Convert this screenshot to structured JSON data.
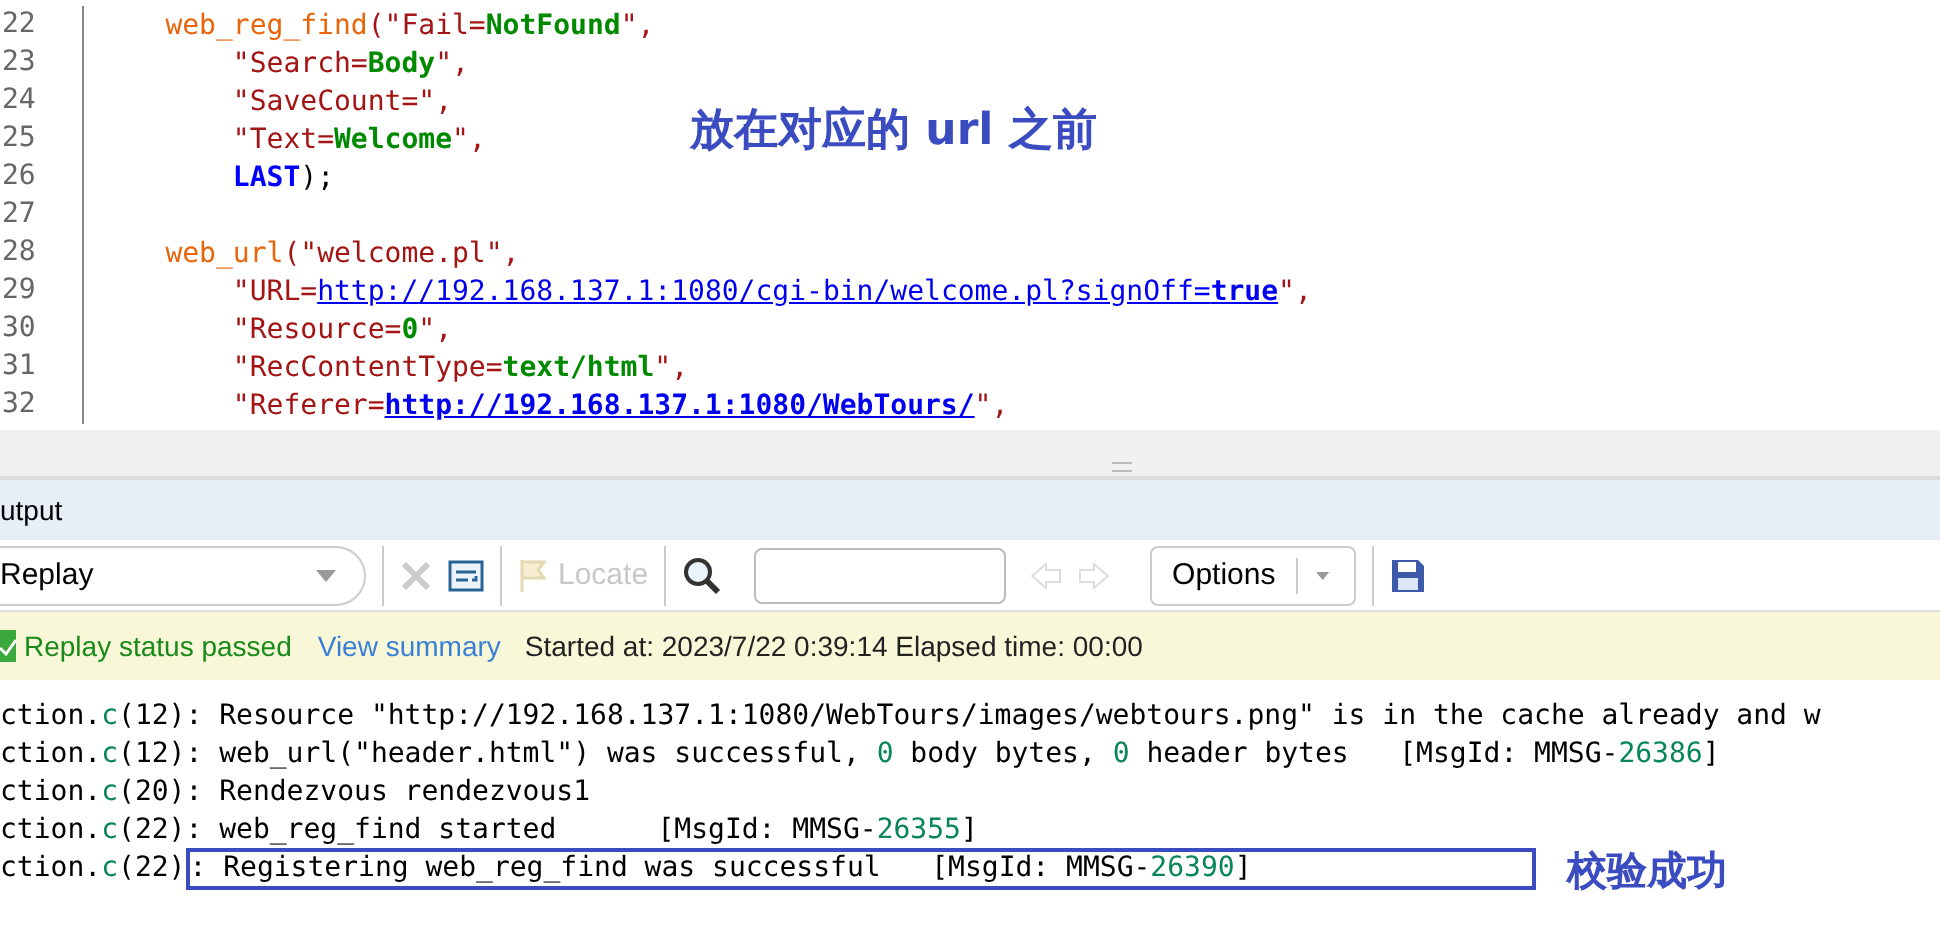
{
  "editor": {
    "lines": [
      {
        "number": "22",
        "kind": "call",
        "tokens": [
          {
            "t": "web_reg_find",
            "kind": "func"
          },
          {
            "t": "(\"Fail=",
            "kind": "str"
          },
          {
            "t": "NotFound",
            "kind": "val"
          },
          {
            "t": "\",",
            "kind": "str"
          }
        ]
      },
      {
        "number": "23",
        "kind": "arg",
        "tokens": [
          {
            "t": "\"Search=",
            "kind": "str"
          },
          {
            "t": "Body",
            "kind": "val"
          },
          {
            "t": "\",",
            "kind": "str"
          }
        ]
      },
      {
        "number": "24",
        "kind": "arg",
        "tokens": [
          {
            "t": "\"SaveCount=\",",
            "kind": "str"
          }
        ]
      },
      {
        "number": "25",
        "kind": "arg",
        "tokens": [
          {
            "t": "\"Text=",
            "kind": "str"
          },
          {
            "t": "Welcome",
            "kind": "val"
          },
          {
            "t": "\",",
            "kind": "str"
          }
        ]
      },
      {
        "number": "26",
        "kind": "arg",
        "tokens": [
          {
            "t": "LAST",
            "kind": "kw"
          },
          {
            "t": ");",
            "kind": "plain"
          }
        ]
      },
      {
        "number": "27"
      },
      {
        "number": "28",
        "kind": "call",
        "tokens": [
          {
            "t": "web_url",
            "kind": "func"
          },
          {
            "t": "(\"welcome.pl\",",
            "kind": "str"
          }
        ]
      },
      {
        "number": "29",
        "kind": "arg",
        "tokens": [
          {
            "t": "\"URL=",
            "kind": "str"
          },
          {
            "t": "http://192.168.137.1:1080/cgi-bin/welcome.pl?signOff=",
            "kind": "link"
          },
          {
            "t": "true",
            "kind": "boldlink"
          },
          {
            "t": "\",",
            "kind": "str"
          }
        ]
      },
      {
        "number": "30",
        "kind": "arg",
        "tokens": [
          {
            "t": "\"Resource=",
            "kind": "str"
          },
          {
            "t": "0",
            "kind": "val"
          },
          {
            "t": "\",",
            "kind": "str"
          }
        ]
      },
      {
        "number": "31",
        "kind": "arg",
        "tokens": [
          {
            "t": "\"RecContentType=",
            "kind": "str"
          },
          {
            "t": "text/html",
            "kind": "val"
          },
          {
            "t": "\",",
            "kind": "str"
          }
        ]
      },
      {
        "number": "32",
        "kind": "arg",
        "tokens": [
          {
            "t": "\"Referer=",
            "kind": "str"
          },
          {
            "t": "http://192.168.137.1:1080/WebTours/",
            "kind": "boldlink"
          },
          {
            "t": "\",",
            "kind": "str"
          }
        ]
      }
    ],
    "annotation": "放在对应的 url 之前"
  },
  "output": {
    "title": "utput",
    "toolbar": {
      "mode": "Replay",
      "locate": "Locate",
      "options": "Options"
    },
    "status": {
      "result": "Replay status passed",
      "link": "View summary",
      "info": "Started at: 2023/7/22 0:39:14 Elapsed time: 00:00"
    },
    "log": [
      {
        "tokens": [
          {
            "t": "ction.",
            "kind": "plain"
          },
          {
            "t": "c",
            "kind": "num"
          },
          {
            "t": "(12): Resource \"http://192.168.137.1:1080/WebTours/images/webtours.png\" is in the cache already and w",
            "kind": "plain"
          }
        ]
      },
      {
        "tokens": [
          {
            "t": "ction.",
            "kind": "plain"
          },
          {
            "t": "c",
            "kind": "num"
          },
          {
            "t": "(12): web_url(\"header.html\") was successful, ",
            "kind": "plain"
          },
          {
            "t": "0",
            "kind": "num"
          },
          {
            "t": " body bytes, ",
            "kind": "plain"
          },
          {
            "t": "0",
            "kind": "num"
          },
          {
            "t": " header bytes   [MsgId: MMSG-",
            "kind": "plain"
          },
          {
            "t": "26386",
            "kind": "num"
          },
          {
            "t": "]",
            "kind": "plain"
          }
        ]
      },
      {
        "tokens": [
          {
            "t": "ction.",
            "kind": "plain"
          },
          {
            "t": "c",
            "kind": "num"
          },
          {
            "t": "(20): Rendezvous rendezvous1",
            "kind": "plain"
          }
        ]
      },
      {
        "tokens": [
          {
            "t": "ction.",
            "kind": "plain"
          },
          {
            "t": "c",
            "kind": "num"
          },
          {
            "t": "(22): web_reg_find started      [MsgId: MMSG-",
            "kind": "plain"
          },
          {
            "t": "26355",
            "kind": "num"
          },
          {
            "t": "]",
            "kind": "plain"
          }
        ]
      },
      {
        "tokens": [
          {
            "t": "ction.",
            "kind": "plain"
          },
          {
            "t": "c",
            "kind": "num"
          },
          {
            "t": "(22)",
            "kind": "plain"
          }
        ],
        "highlighted_tokens": [
          {
            "t": ": Registering web_reg_find was successful   [MsgId: MMSG-",
            "kind": "plain"
          },
          {
            "t": "26390",
            "kind": "num"
          },
          {
            "t": "]",
            "kind": "plain"
          }
        ],
        "annotation": "校验成功"
      }
    ]
  }
}
